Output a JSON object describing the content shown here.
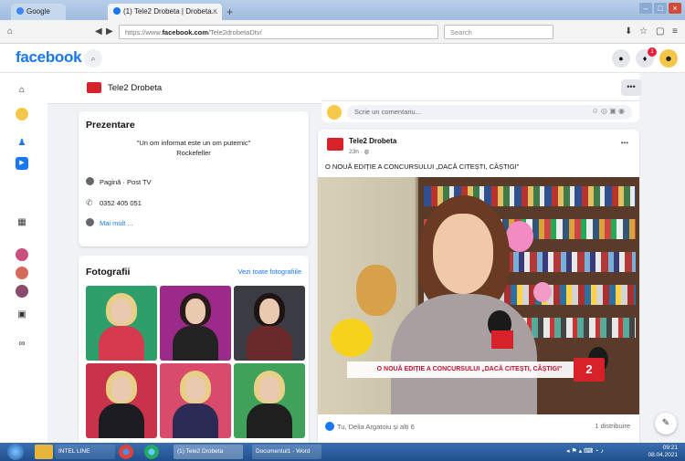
{
  "browser": {
    "tabs": [
      {
        "label": "Google"
      },
      {
        "label": "(1) Tele2 Drobeta | Drobeta..."
      }
    ],
    "url_prefix": "https://www.",
    "url_domain": "facebook.com",
    "url_path": "/Tele2drobetaDtv/",
    "search_placeholder": "Search"
  },
  "facebook": {
    "logo_text": "facebook",
    "notification_count": "1"
  },
  "page": {
    "name": "Tele2 Drobeta"
  },
  "intro": {
    "title": "Prezentare",
    "quote_line1": "\"Un om informat este un om puternic\"",
    "quote_line2": "Rockefeller",
    "rows": [
      {
        "icon": "info-icon",
        "text": "Pagină · Post TV"
      },
      {
        "icon": "phone-icon",
        "text": "0352 405 051"
      },
      {
        "icon": "more-icon",
        "text": "Mai mult ..."
      }
    ]
  },
  "photos": {
    "title": "Fotografii",
    "see_all": "Vezi toate fotografiile"
  },
  "comment": {
    "placeholder": "Scrie un comentariu..."
  },
  "post": {
    "author": "Tele2 Drobeta",
    "time": "23h",
    "text": "O NOUĂ EDIȚIE A CONCURSULUI „DACĂ CITEȘTI, CÂȘTIGI\"",
    "video_caption": "O NOUĂ EDIȚIE A CONCURSULUI „DACĂ CITEȘTI, CÂȘTIGI\"",
    "video_badge": "2",
    "reactions_text": "Tu, Delia Argatoiu și alți 6",
    "shares_text": "1 distribuire"
  },
  "taskbar": {
    "items": [
      "INTEL LINE",
      "(1) Tele2 Drobeta",
      "Documentul1 - Word"
    ],
    "time": "09:21",
    "date": "08.04.2021"
  },
  "colors": {
    "fb_blue": "#1877f2",
    "tele2_red": "#d8222a",
    "content_bg": "#f0f2f5"
  }
}
